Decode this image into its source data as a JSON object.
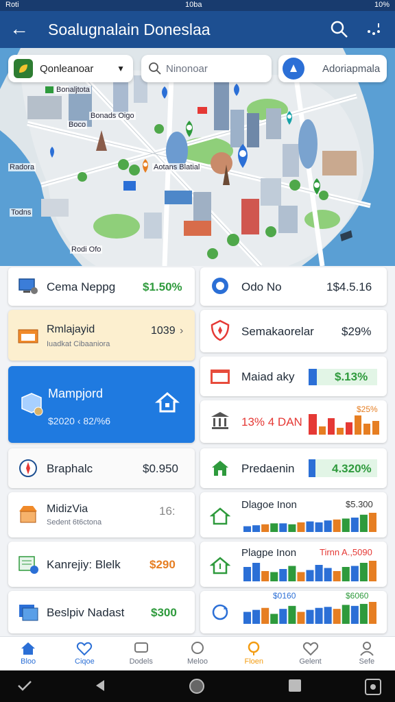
{
  "status_bar": {
    "left": "Roti",
    "center": "10ba",
    "right": "10%"
  },
  "app_bar": {
    "title": "Soalugnalain Doneslaa",
    "back_icon": "arrow-left-icon",
    "search_icon": "search-icon",
    "more_icon": "more-icon"
  },
  "filters": {
    "category": {
      "label": "Qonleanoar"
    },
    "search": {
      "placeholder": "Ninonoar"
    },
    "location": {
      "label": "Adoriapmala"
    }
  },
  "map_labels": [
    {
      "text": "Bonaljtota"
    },
    {
      "text": "Bonads Oigo"
    },
    {
      "text": "Boco"
    },
    {
      "text": "Aotans Blatial"
    },
    {
      "text": "Radora"
    },
    {
      "text": "Todns"
    },
    {
      "text": "Rodi Ofo"
    }
  ],
  "left_cards": [
    {
      "label": "Cema Neppg",
      "value": "$1.50%"
    },
    {
      "label": "Rmlajayid",
      "sub": "Iuadkat Cibaaniora",
      "value": "1039"
    },
    {
      "label": "Mampjord",
      "sub": "$2020 ‹ 82/%6"
    },
    {
      "label": "Braphalc",
      "value": "$0.950"
    },
    {
      "label": "MidizVia",
      "sub": "Sedent 6t6ctona",
      "value": "16:"
    },
    {
      "label": "Kanrejiy: Blelk",
      "value": "$290"
    },
    {
      "label": "Beslpiv Nadast",
      "value": "$300"
    }
  ],
  "right_cards": [
    {
      "label": "Odo No",
      "value": "1$4.5.16"
    },
    {
      "label": "Semakaorelar",
      "value": "$29%"
    },
    {
      "label": "Maiad aky",
      "value": "$.13%",
      "progress": 0.12
    },
    {
      "label": "13% 4 DAN",
      "value": "$25%"
    },
    {
      "label": "Predaenin",
      "value": "4.320%",
      "progress": 0.1
    },
    {
      "label": "Dlagoe Inon",
      "value": "$5.300",
      "bars": [
        6,
        7,
        8,
        9,
        9,
        8,
        10,
        11,
        10,
        12,
        13,
        14,
        15,
        18,
        20
      ]
    },
    {
      "label": "Plagpe Inon",
      "value": "Tirnn A.,5090",
      "bars": [
        14,
        18,
        10,
        9,
        12,
        15,
        9,
        11,
        16,
        13,
        10,
        14,
        15,
        18,
        20
      ]
    },
    {
      "label": "",
      "sub": "$0160",
      "value": "$6060",
      "bars": [
        12,
        14,
        16,
        10,
        15,
        18,
        12,
        14,
        16,
        17,
        15,
        19,
        18,
        20,
        22
      ]
    }
  ],
  "bottom_nav": [
    {
      "label": "Bloo",
      "icon": "home-icon"
    },
    {
      "label": "Ciqoe",
      "icon": "heart-icon"
    },
    {
      "label": "Dodels",
      "icon": "chat-icon"
    },
    {
      "label": "Meloo",
      "icon": "bubble-icon"
    },
    {
      "label": "Floen",
      "icon": "pin-icon"
    },
    {
      "label": "Gelent",
      "icon": "heart-outline-icon"
    },
    {
      "label": "Sefe",
      "icon": "person-icon"
    }
  ],
  "colors": {
    "primary": "#1d4f91",
    "accent": "#2b6fd6",
    "green": "#2e9a3c",
    "orange": "#e67e22",
    "red": "#e53935"
  }
}
